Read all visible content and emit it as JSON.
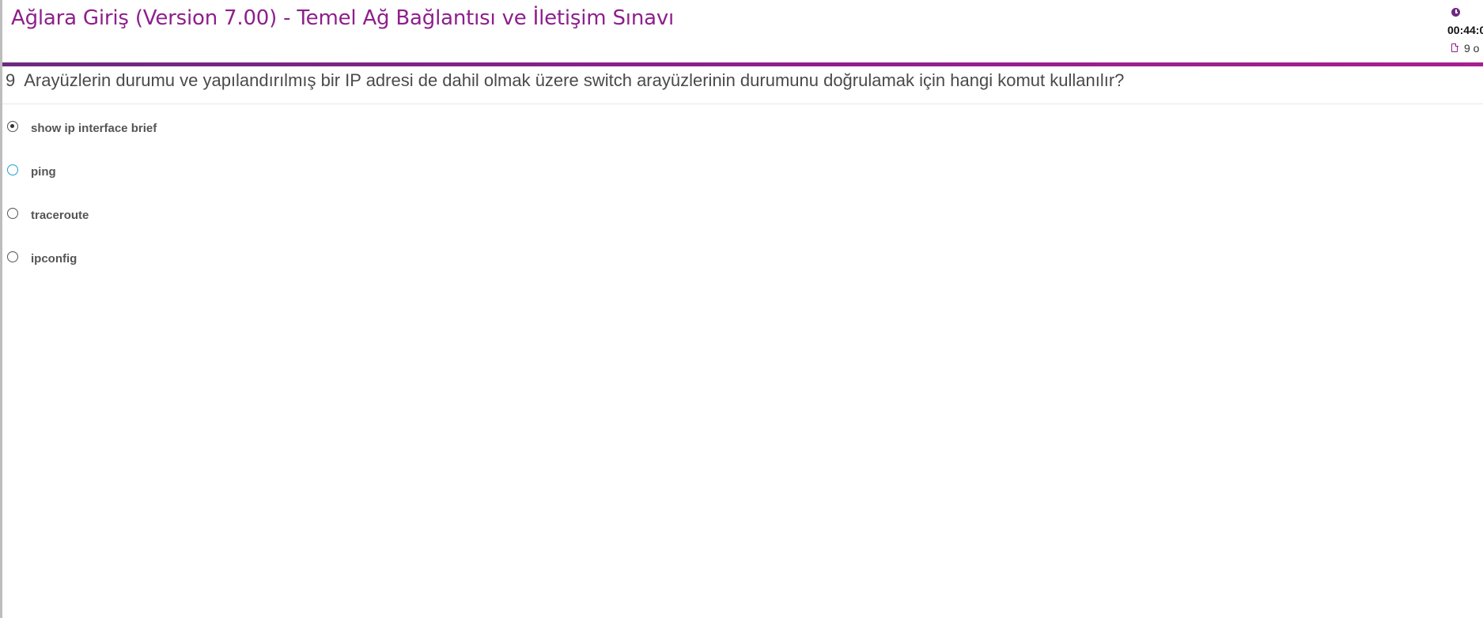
{
  "header": {
    "title": "Ağlara Giriş (Version 7.00) - Temel Ağ Bağlantısı ve İletişim Sınavı",
    "timer": "00:44:0",
    "progress": "9 o",
    "clock_icon": "clock-icon",
    "doc_icon": "document-icon"
  },
  "colors": {
    "brand": "#8e1f8c",
    "brand_dark": "#6c2a80",
    "radio_hover": "#1fa0d2"
  },
  "question": {
    "number": "9",
    "text": "Arayüzlerin durumu ve yapılandırılmış bir IP adresi de dahil olmak üzere switch arayüzlerinin durumunu doğrulamak için hangi komut kullanılır?"
  },
  "options": [
    {
      "label": "show ip interface brief",
      "selected": true
    },
    {
      "label": "ping",
      "selected": false
    },
    {
      "label": "traceroute",
      "selected": false
    },
    {
      "label": "ipconfig",
      "selected": false
    }
  ]
}
